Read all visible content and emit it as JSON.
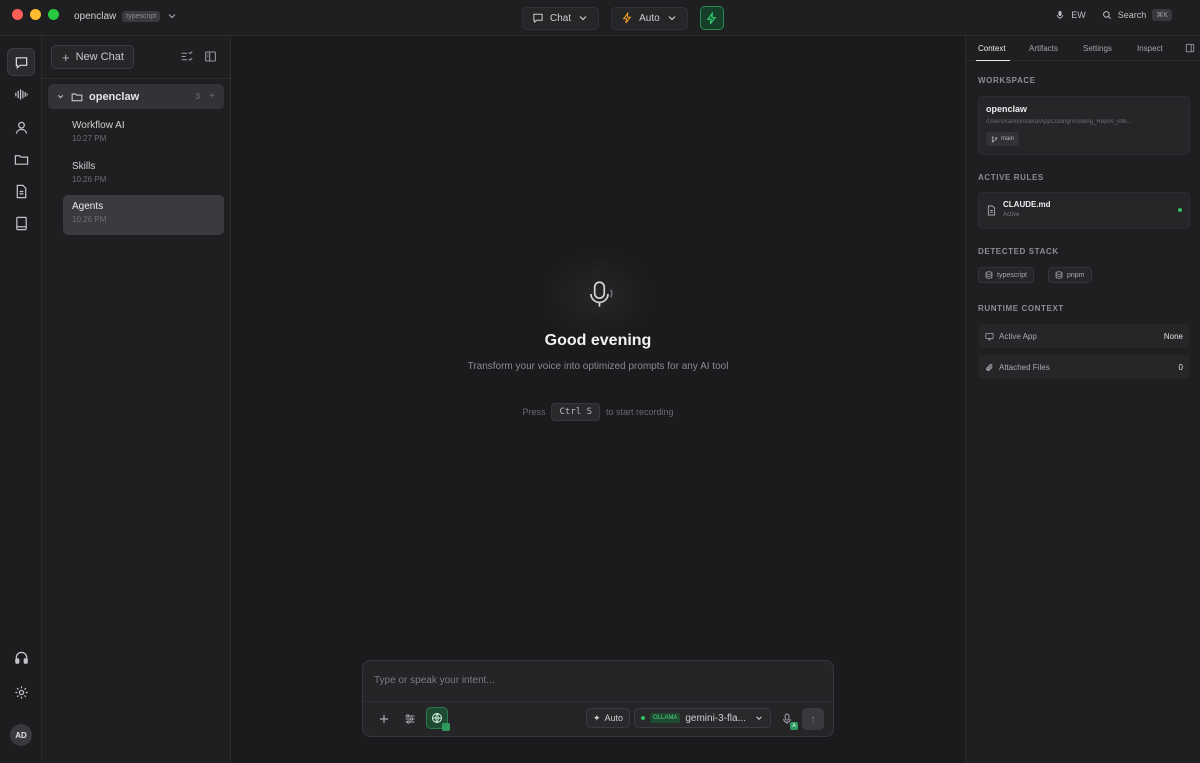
{
  "titlebar": {
    "workspace_name": "openclaw",
    "workspace_badge": "typescript",
    "mode_label": "Chat",
    "auto_label": "Auto",
    "user_initials_short": "EW",
    "search_label": "Search",
    "search_shortcut": "⌘K"
  },
  "rail": {
    "items": [
      "chat",
      "voice",
      "profile",
      "folder",
      "document",
      "book"
    ],
    "avatar_initials": "AD"
  },
  "sidebar": {
    "new_chat_label": "New Chat",
    "folder": {
      "name": "openclaw",
      "count": "3",
      "add": "+"
    },
    "chats": [
      {
        "title": "Workflow AI",
        "time": "10:27 PM"
      },
      {
        "title": "Skills",
        "time": "10:26 PM"
      },
      {
        "title": "Agents",
        "time": "10:26 PM"
      }
    ]
  },
  "main": {
    "greeting": "Good evening",
    "subtitle": "Transform your voice into optimized prompts for any AI tool",
    "hint_prefix": "Press",
    "hint_key": "Ctrl S",
    "hint_suffix": "to start recording",
    "composer": {
      "placeholder": "Type or speak your intent...",
      "auto_label": "Auto",
      "provider": "OLLAMA",
      "model": "gemini-3-fla...",
      "mic_badge": "A"
    }
  },
  "right_panel": {
    "tabs": [
      "Context",
      "Artifacts",
      "Settings",
      "Inspect"
    ],
    "workspace_heading": "WORKSPACE",
    "workspace_name": "openclaw",
    "workspace_path": "/Users/carlosrodera/AppCoding/Vcoding_Repos_inte...",
    "branch": "main",
    "rules_heading": "ACTIVE RULES",
    "rule_name": "CLAUDE.md",
    "rule_status": "Active",
    "stack_heading": "DETECTED STACK",
    "stack": [
      "typescript",
      "pnpm"
    ],
    "runtime_heading": "RUNTIME CONTEXT",
    "runtime": [
      {
        "label": "Active App",
        "value": "None"
      },
      {
        "label": "Attached Files",
        "value": "0"
      }
    ]
  },
  "colors": {
    "accent_green": "#2fbf66",
    "traffic_red": "#fe5f57",
    "traffic_yellow": "#febc2e",
    "traffic_green": "#28c840",
    "bolt_orange": "#f0a020"
  }
}
